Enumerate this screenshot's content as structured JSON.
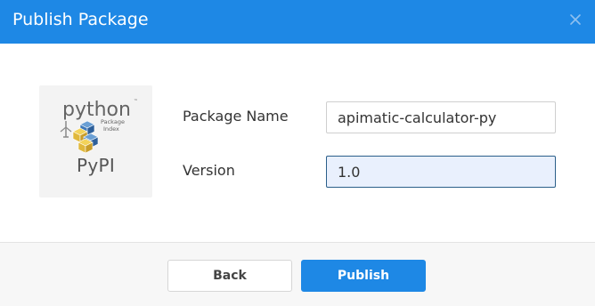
{
  "dialog": {
    "title": "Publish Package",
    "close_icon": "close-icon"
  },
  "logo": {
    "wordmark": "python",
    "subtitle_line1": "Package",
    "subtitle_line2": "Index",
    "caption": "PyPI"
  },
  "form": {
    "package_name_label": "Package Name",
    "package_name_value": "apimatic-calculator-py",
    "version_label": "Version",
    "version_value": "1.0"
  },
  "footer": {
    "back_label": "Back",
    "publish_label": "Publish"
  },
  "colors": {
    "header": "#1e88e5",
    "primary_button": "#1e88e5",
    "focused_input_bg": "#e9f0fd"
  }
}
